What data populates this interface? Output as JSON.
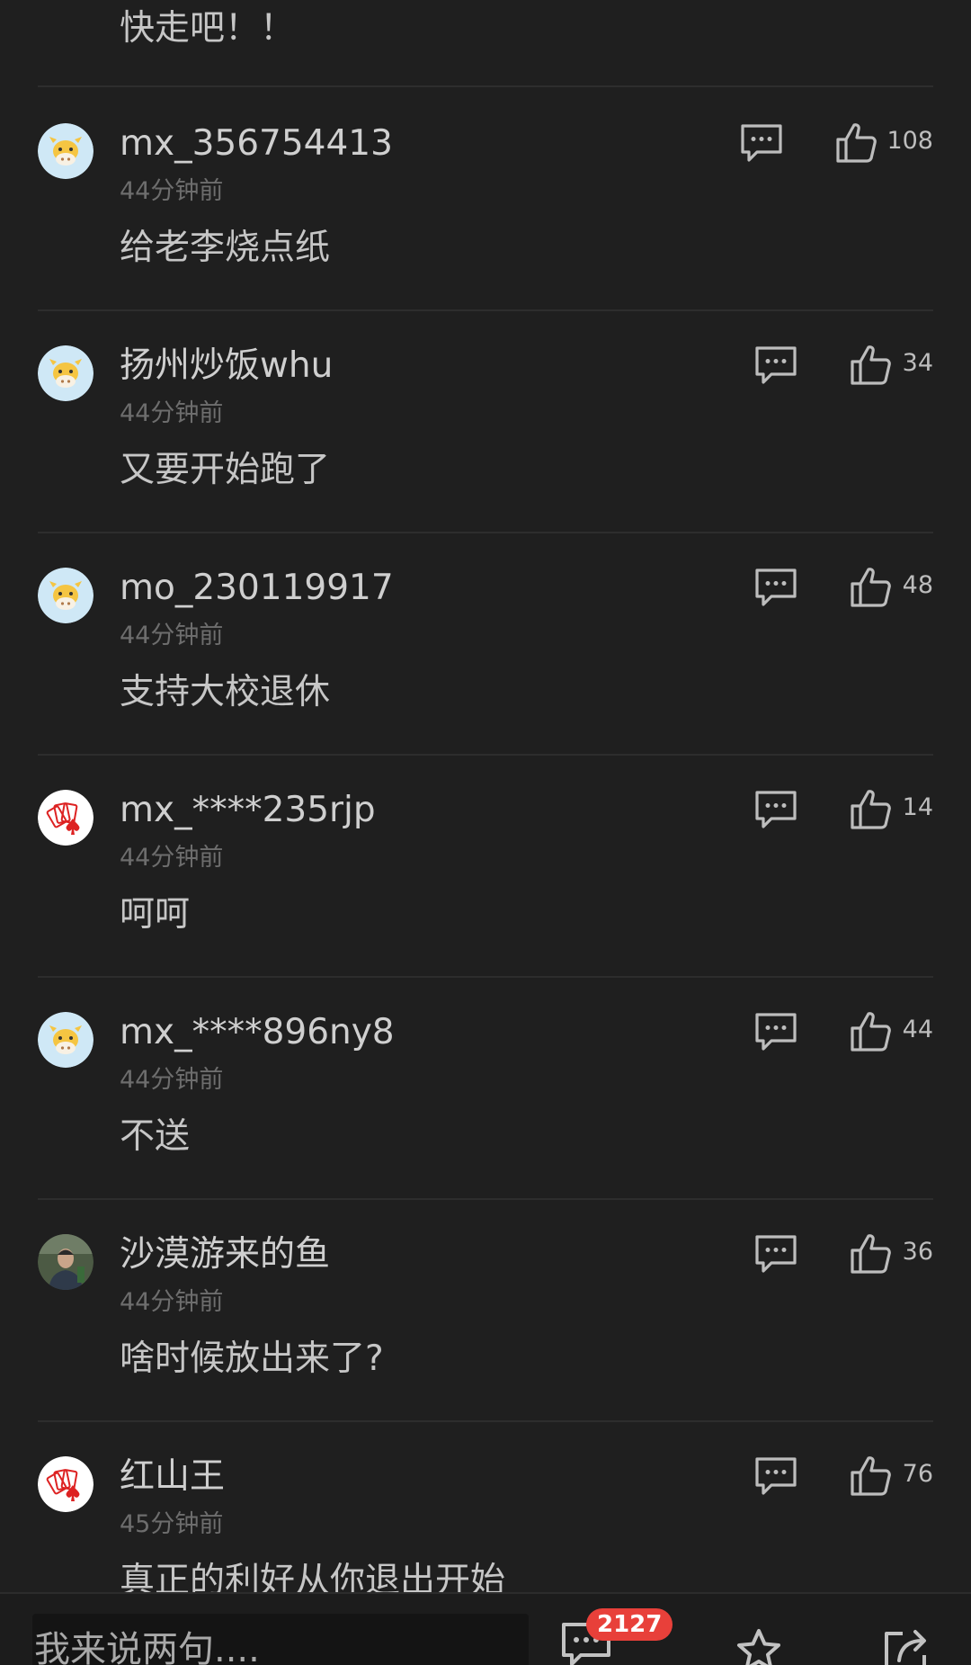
{
  "top_comment": {
    "text": "快走吧！！"
  },
  "comments": [
    {
      "username": "mx_356754413",
      "time": "44分钟前",
      "text": "给老李烧点纸",
      "likes": "108",
      "avatar_icon": "cow-avatar-icon"
    },
    {
      "username": "扬州炒饭whu",
      "time": "44分钟前",
      "text": "又要开始跑了",
      "likes": "34",
      "avatar_icon": "cow-avatar-icon"
    },
    {
      "username": "mo_230119917",
      "time": "44分钟前",
      "text": "支持大校退休",
      "likes": "48",
      "avatar_icon": "cow-avatar-icon"
    },
    {
      "username": "mx_****235rjp",
      "time": "44分钟前",
      "text": "呵呵",
      "likes": "14",
      "avatar_icon": "playing-cards-avatar-icon"
    },
    {
      "username": "mx_****896ny8",
      "time": "44分钟前",
      "text": "不送",
      "likes": "44",
      "avatar_icon": "cow-avatar-icon"
    },
    {
      "username": "沙漠游来的鱼",
      "time": "44分钟前",
      "text": "啥时候放出来了?",
      "likes": "36",
      "avatar_icon": "photo-avatar-icon"
    },
    {
      "username": "红山王",
      "time": "45分钟前",
      "text": "真正的利好从你退出开始",
      "likes": "76",
      "avatar_icon": "playing-cards-avatar-icon"
    }
  ],
  "bottom_bar": {
    "input_placeholder": "我来说两句....",
    "comment_count": "2127",
    "icons": [
      "comments-icon",
      "star-icon",
      "share-icon"
    ]
  },
  "colors": {
    "background": "#1f1f1f",
    "badge": "#e8403a",
    "divider": "#2d2d2d"
  }
}
